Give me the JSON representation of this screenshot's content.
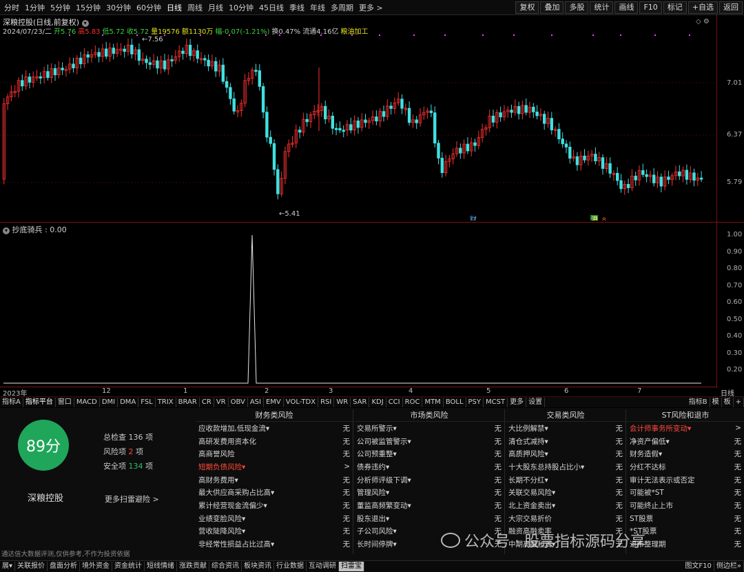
{
  "periods": [
    "分时",
    "1分钟",
    "5分钟",
    "15分钟",
    "30分钟",
    "60分钟",
    "日线",
    "周线",
    "月线",
    "10分钟",
    "45日线",
    "季线",
    "年线",
    "多周期",
    "更多 >"
  ],
  "active_period": "日线",
  "right_tools": [
    "复权",
    "叠加",
    "多股",
    "统计",
    "画线",
    "F10",
    "标记",
    "+自选",
    "返回"
  ],
  "stock_title": "深粮控股(日线,前复权)",
  "quote": {
    "date": "2024/07/23/二",
    "open": "开5.76",
    "high": "高5.83",
    "low": "低5.72",
    "close": "收5.72",
    "volume": "量19576",
    "amount": "额1130万",
    "change": "幅-0.07(-1.21%)",
    "turnover": "换0.47%",
    "float": "流通4.16亿",
    "industry": "粮油加工"
  },
  "price_labels": [
    "7.01",
    "6.37",
    "5.79"
  ],
  "high_mark": "7.56",
  "low_mark": "5.41",
  "event_markers": [
    "财",
    "港",
    "8"
  ],
  "indicator_title": "抄底骑兵 : 0.00",
  "indicator_labels": [
    "1.00",
    "0.90",
    "0.80",
    "0.70",
    "0.60",
    "0.50",
    "0.40",
    "0.30",
    "0.20"
  ],
  "date_labels": [
    "2023年",
    "12",
    "1",
    "2",
    "3",
    "4",
    "5",
    "6",
    "7"
  ],
  "date_right": "日线",
  "indicator_tabs": [
    "指标A",
    "指标平台",
    "窗口",
    "MACD",
    "DMI",
    "DMA",
    "FSL",
    "TRIX",
    "BRAR",
    "CR",
    "VR",
    "OBV",
    "ASI",
    "EMV",
    "VOL-TDX",
    "RSI",
    "WR",
    "SAR",
    "KDJ",
    "CCI",
    "ROC",
    "MTM",
    "BOLL",
    "PSY",
    "MCST",
    "更多",
    "设置"
  ],
  "tabs_right": [
    "指标B",
    "模",
    "板",
    "+"
  ],
  "score": "89分",
  "stats": [
    {
      "label": "总检查",
      "value": "136",
      "unit": "项",
      "color": "#d8d8d8"
    },
    {
      "label": "风险项",
      "value": "2",
      "unit": "项",
      "color": "#ff4a3a"
    },
    {
      "label": "安全项",
      "value": "134",
      "unit": "项",
      "color": "#2fc060"
    }
  ],
  "stock_name": "深粮控股",
  "more_scan": "更多扫雷避险 >",
  "columns": [
    {
      "title": "财务类风险",
      "rows": [
        {
          "label": "应收款增加,低现金流▾",
          "value": "无"
        },
        {
          "label": "高研发费用资本化",
          "value": "无"
        },
        {
          "label": "高商誉风险",
          "value": "无"
        },
        {
          "label": "短期负债风险▾",
          "value": ">",
          "red": true
        },
        {
          "label": "高财务费用▾",
          "value": "无"
        },
        {
          "label": "最大供应商采购占比高▾",
          "value": "无"
        },
        {
          "label": "累计经营现金流偏少▾",
          "value": "无"
        },
        {
          "label": "业绩变脸风险▾",
          "value": "无"
        },
        {
          "label": "营收陡降风险▾",
          "value": "无"
        },
        {
          "label": "非经常性损益占比过高▾",
          "value": "无"
        }
      ]
    },
    {
      "title": "市场类风险",
      "rows": [
        {
          "label": "交易所警示▾",
          "value": "无"
        },
        {
          "label": "公司被监管警示▾",
          "value": "无"
        },
        {
          "label": "公司预重整▾",
          "value": "无"
        },
        {
          "label": "债券违约▾",
          "value": "无"
        },
        {
          "label": "分析师评级下调▾",
          "value": "无"
        },
        {
          "label": "管理风险▾",
          "value": "无"
        },
        {
          "label": "董监高频繁变动▾",
          "value": "无"
        },
        {
          "label": "股东退出▾",
          "value": "无"
        },
        {
          "label": "子公司风险▾",
          "value": "无"
        },
        {
          "label": "长时间停牌▾",
          "value": "无"
        }
      ]
    },
    {
      "title": "交易类风险",
      "rows": [
        {
          "label": "大比例解禁▾",
          "value": "无"
        },
        {
          "label": "清仓式减持▾",
          "value": "无"
        },
        {
          "label": "高质押风险▾",
          "value": "无"
        },
        {
          "label": "十大股东总持股占比小▾",
          "value": "无"
        },
        {
          "label": "长期不分红▾",
          "value": "无"
        },
        {
          "label": "关联交易风险▾",
          "value": "无"
        },
        {
          "label": "北上资金卖出▾",
          "value": "无"
        },
        {
          "label": "大宗交易折价",
          "value": "无"
        },
        {
          "label": "融资高融卖率",
          "value": "无"
        },
        {
          "label": "中期高融利润▾",
          "value": "无"
        }
      ]
    },
    {
      "title": "ST风险和退市",
      "rows": [
        {
          "label": "会计师事务所变动▾",
          "value": ">",
          "red": true
        },
        {
          "label": "净资产偏低▾",
          "value": "无"
        },
        {
          "label": "财务造假▾",
          "value": "无"
        },
        {
          "label": "分红不达标",
          "value": "无"
        },
        {
          "label": "审计无法表示或否定",
          "value": "无"
        },
        {
          "label": "可能被*ST",
          "value": "无"
        },
        {
          "label": "可能终止上市",
          "value": "无"
        },
        {
          "label": "ST股票",
          "value": "无"
        },
        {
          "label": "*ST股票",
          "value": "无"
        },
        {
          "label": "退市整理期",
          "value": "无"
        }
      ]
    }
  ],
  "disclaimer": "通达信大数据评测,仅供参考,不作为投资依据",
  "watermark": "公众号 · 股票指标源码分享",
  "status_tabs": [
    "展▾",
    "关联报价",
    "盘面分析",
    "境外资金",
    "资金统计",
    "短线情绪",
    "涨跌贡献",
    "综合资讯",
    "板块资讯",
    "行业数据",
    "互动调研",
    "扫雷宝"
  ],
  "status_active": "扫雷宝",
  "status_right": [
    "图文F10",
    "侧边栏»"
  ],
  "colors": {
    "up": "#ff3030",
    "down": "#40e0e0",
    "event": "#ff40ff",
    "accent": "#1fa65a",
    "border": "#7a1212"
  }
}
